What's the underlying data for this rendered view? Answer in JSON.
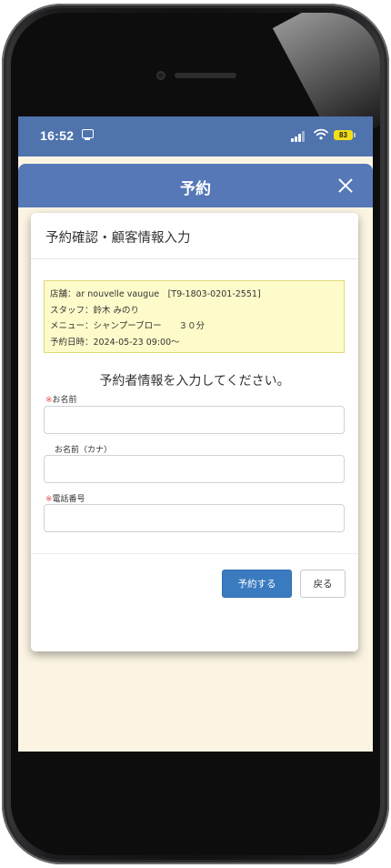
{
  "status_bar": {
    "time": "16:52",
    "battery": "83",
    "icons": [
      "screen-mirroring-icon",
      "signal-icon",
      "wifi-icon",
      "battery-icon"
    ]
  },
  "header": {
    "title": "予約",
    "close_icon": "close-icon"
  },
  "dialog": {
    "title": "予約確認・顧客情報入力",
    "info": [
      "店舗：ar nouvelle vaugue　[T9-1803-0201-2551]",
      "スタッフ：鈴木 みのり",
      "メニュー：シャンプーブロー　　３０分",
      "予約日時：2024-05-23 09:00〜"
    ],
    "prompt": "予約者情報を入力してください。",
    "fields": [
      {
        "required_mark": "※",
        "label": "お名前",
        "value": ""
      },
      {
        "required_mark": "",
        "label": "お名前（カナ）",
        "value": ""
      },
      {
        "required_mark": "※",
        "label": "電話番号",
        "value": ""
      }
    ],
    "submit_label": "予約する",
    "back_label": "戻る"
  },
  "colors": {
    "header_blue": "#5678b6",
    "status_bar_blue": "#4f73ad",
    "page_background": "#fbf4e3",
    "info_box": "#fdfbc9",
    "primary_button": "#3a7bc0",
    "required_mark": "#e84a4a"
  }
}
